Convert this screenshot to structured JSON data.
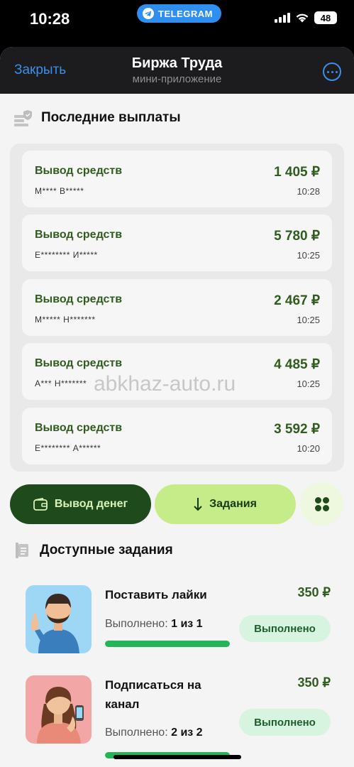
{
  "status_bar": {
    "time": "10:28",
    "telegram_pill": "TELEGRAM",
    "battery": "48"
  },
  "header": {
    "close_label": "Закрыть",
    "title": "Биржа Труда",
    "subtitle": "мини-приложение"
  },
  "payouts": {
    "section_title": "Последние выплаты",
    "items": [
      {
        "label": "Вывод средств",
        "name": "М**** В*****",
        "amount": "1 405 ₽",
        "time": "10:28"
      },
      {
        "label": "Вывод средств",
        "name": "Е******** И*****",
        "amount": "5 780 ₽",
        "time": "10:25"
      },
      {
        "label": "Вывод средств",
        "name": "М***** Н*******",
        "amount": "2 467 ₽",
        "time": "10:25"
      },
      {
        "label": "Вывод средств",
        "name": "А*** Н*******",
        "amount": "4 485 ₽",
        "time": "10:25"
      },
      {
        "label": "Вывод средств",
        "name": "Е******** А******",
        "amount": "3 592 ₽",
        "time": "10:20"
      }
    ]
  },
  "actions": {
    "withdraw_label": "Вывод денег",
    "tasks_label": "Задания"
  },
  "tasks": {
    "section_title": "Доступные задания",
    "items": [
      {
        "name": "Поставить лайки",
        "price": "350 ₽",
        "progress_label": "Выполнено:",
        "progress_value": "1 из 1",
        "progress_fraction": 1.0,
        "status": "Выполнено"
      },
      {
        "name": "Подписаться на канал",
        "price": "350 ₽",
        "progress_label": "Выполнено:",
        "progress_value": "2 из 2",
        "progress_fraction": 1.0,
        "status": "Выполнено"
      }
    ]
  },
  "watermark": "abkhaz-auto.ru",
  "colors": {
    "accent_blue": "#3a8fe8",
    "dark_green": "#1f4a1c",
    "light_green": "#c6ec8a",
    "progress_green": "#22b455"
  }
}
